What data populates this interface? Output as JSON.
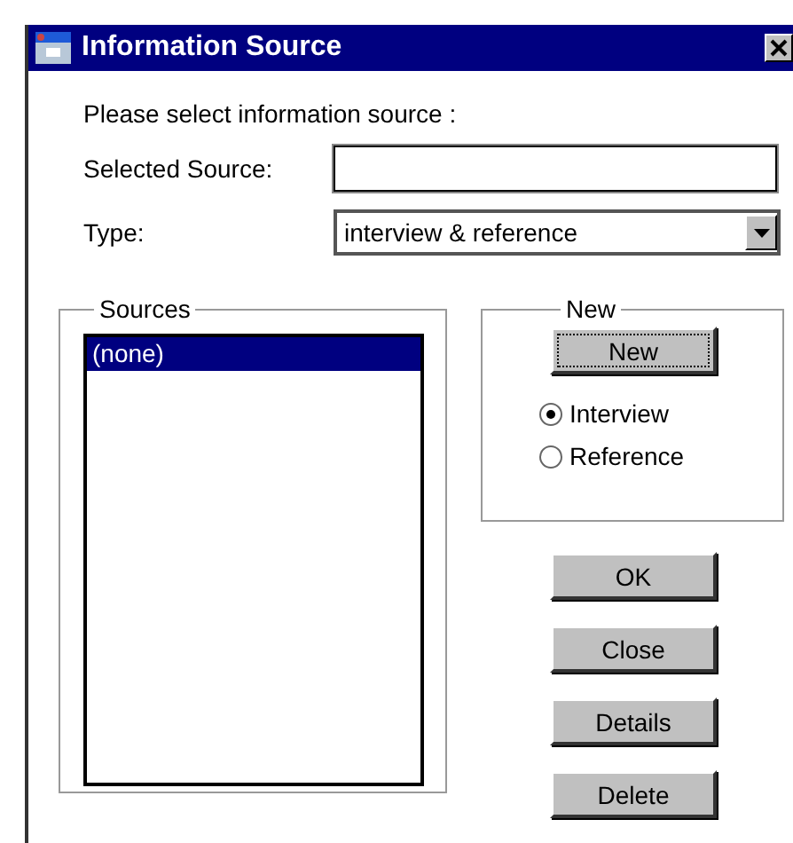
{
  "window": {
    "title": "Information Source"
  },
  "prompt": "Please select information source :",
  "selected_source": {
    "label": "Selected Source:"
  },
  "type": {
    "label": "Type:",
    "value": "interview & reference"
  },
  "sources": {
    "title": "Sources",
    "items": [
      {
        "text": "(none)",
        "selected": true
      }
    ]
  },
  "new_group": {
    "title": "New",
    "button": "New",
    "radios": [
      {
        "label": "Interview",
        "selected": true
      },
      {
        "label": "Reference",
        "selected": false
      }
    ]
  },
  "buttons": [
    "OK",
    "Close",
    "Details",
    "Delete"
  ]
}
